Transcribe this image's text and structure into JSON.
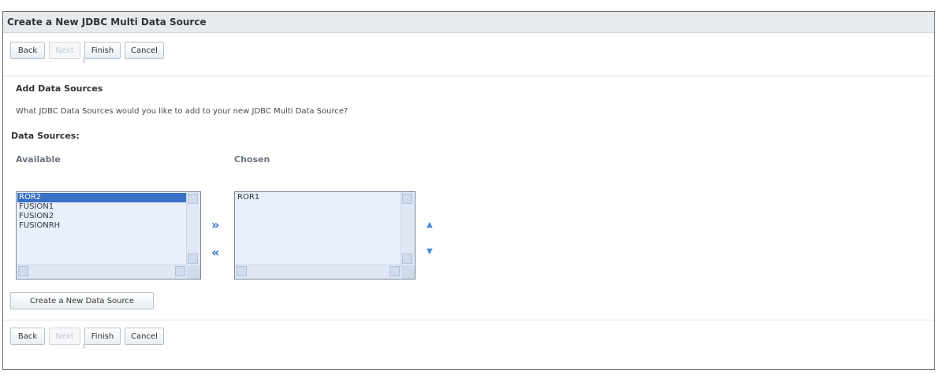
{
  "window": {
    "title": "Create a New JDBC Multi Data Source"
  },
  "top_toolbar": {
    "back_label": "Back",
    "next_label": "Next",
    "finish_label": "Finish",
    "cancel_label": "Cancel"
  },
  "section": {
    "heading": "Add Data Sources",
    "instruction": "What JDBC Data Sources would you like to add to your new JDBC Multi Data Source?",
    "data_sources_label": "Data Sources:"
  },
  "available": {
    "heading": "Available",
    "items": [
      {
        "label": "ROR2",
        "selected": true
      },
      {
        "label": "FUSION1",
        "selected": false
      },
      {
        "label": "FUSION2",
        "selected": false
      },
      {
        "label": "FUSIONRH",
        "selected": false
      }
    ]
  },
  "chosen": {
    "heading": "Chosen",
    "items": [
      {
        "label": "ROR1",
        "selected": false
      }
    ]
  },
  "transfer": {
    "add_icon": "double-chevron-right-icon",
    "remove_icon": "double-chevron-left-icon",
    "add_glyph": "»",
    "remove_glyph": "«"
  },
  "reorder": {
    "up_icon": "triangle-up-icon",
    "down_icon": "triangle-down-icon",
    "up_glyph": "▲",
    "down_glyph": "▼"
  },
  "create_button": {
    "label": "Create a New Data Source"
  },
  "bottom_toolbar": {
    "back_label": "Back",
    "next_label": "Next",
    "finish_label": "Finish",
    "cancel_label": "Cancel"
  },
  "colors": {
    "accent": "#3670c4",
    "selection": "#3a6fc6",
    "list_background": "#e9f0fa",
    "title_bar": "#e7ebee"
  }
}
